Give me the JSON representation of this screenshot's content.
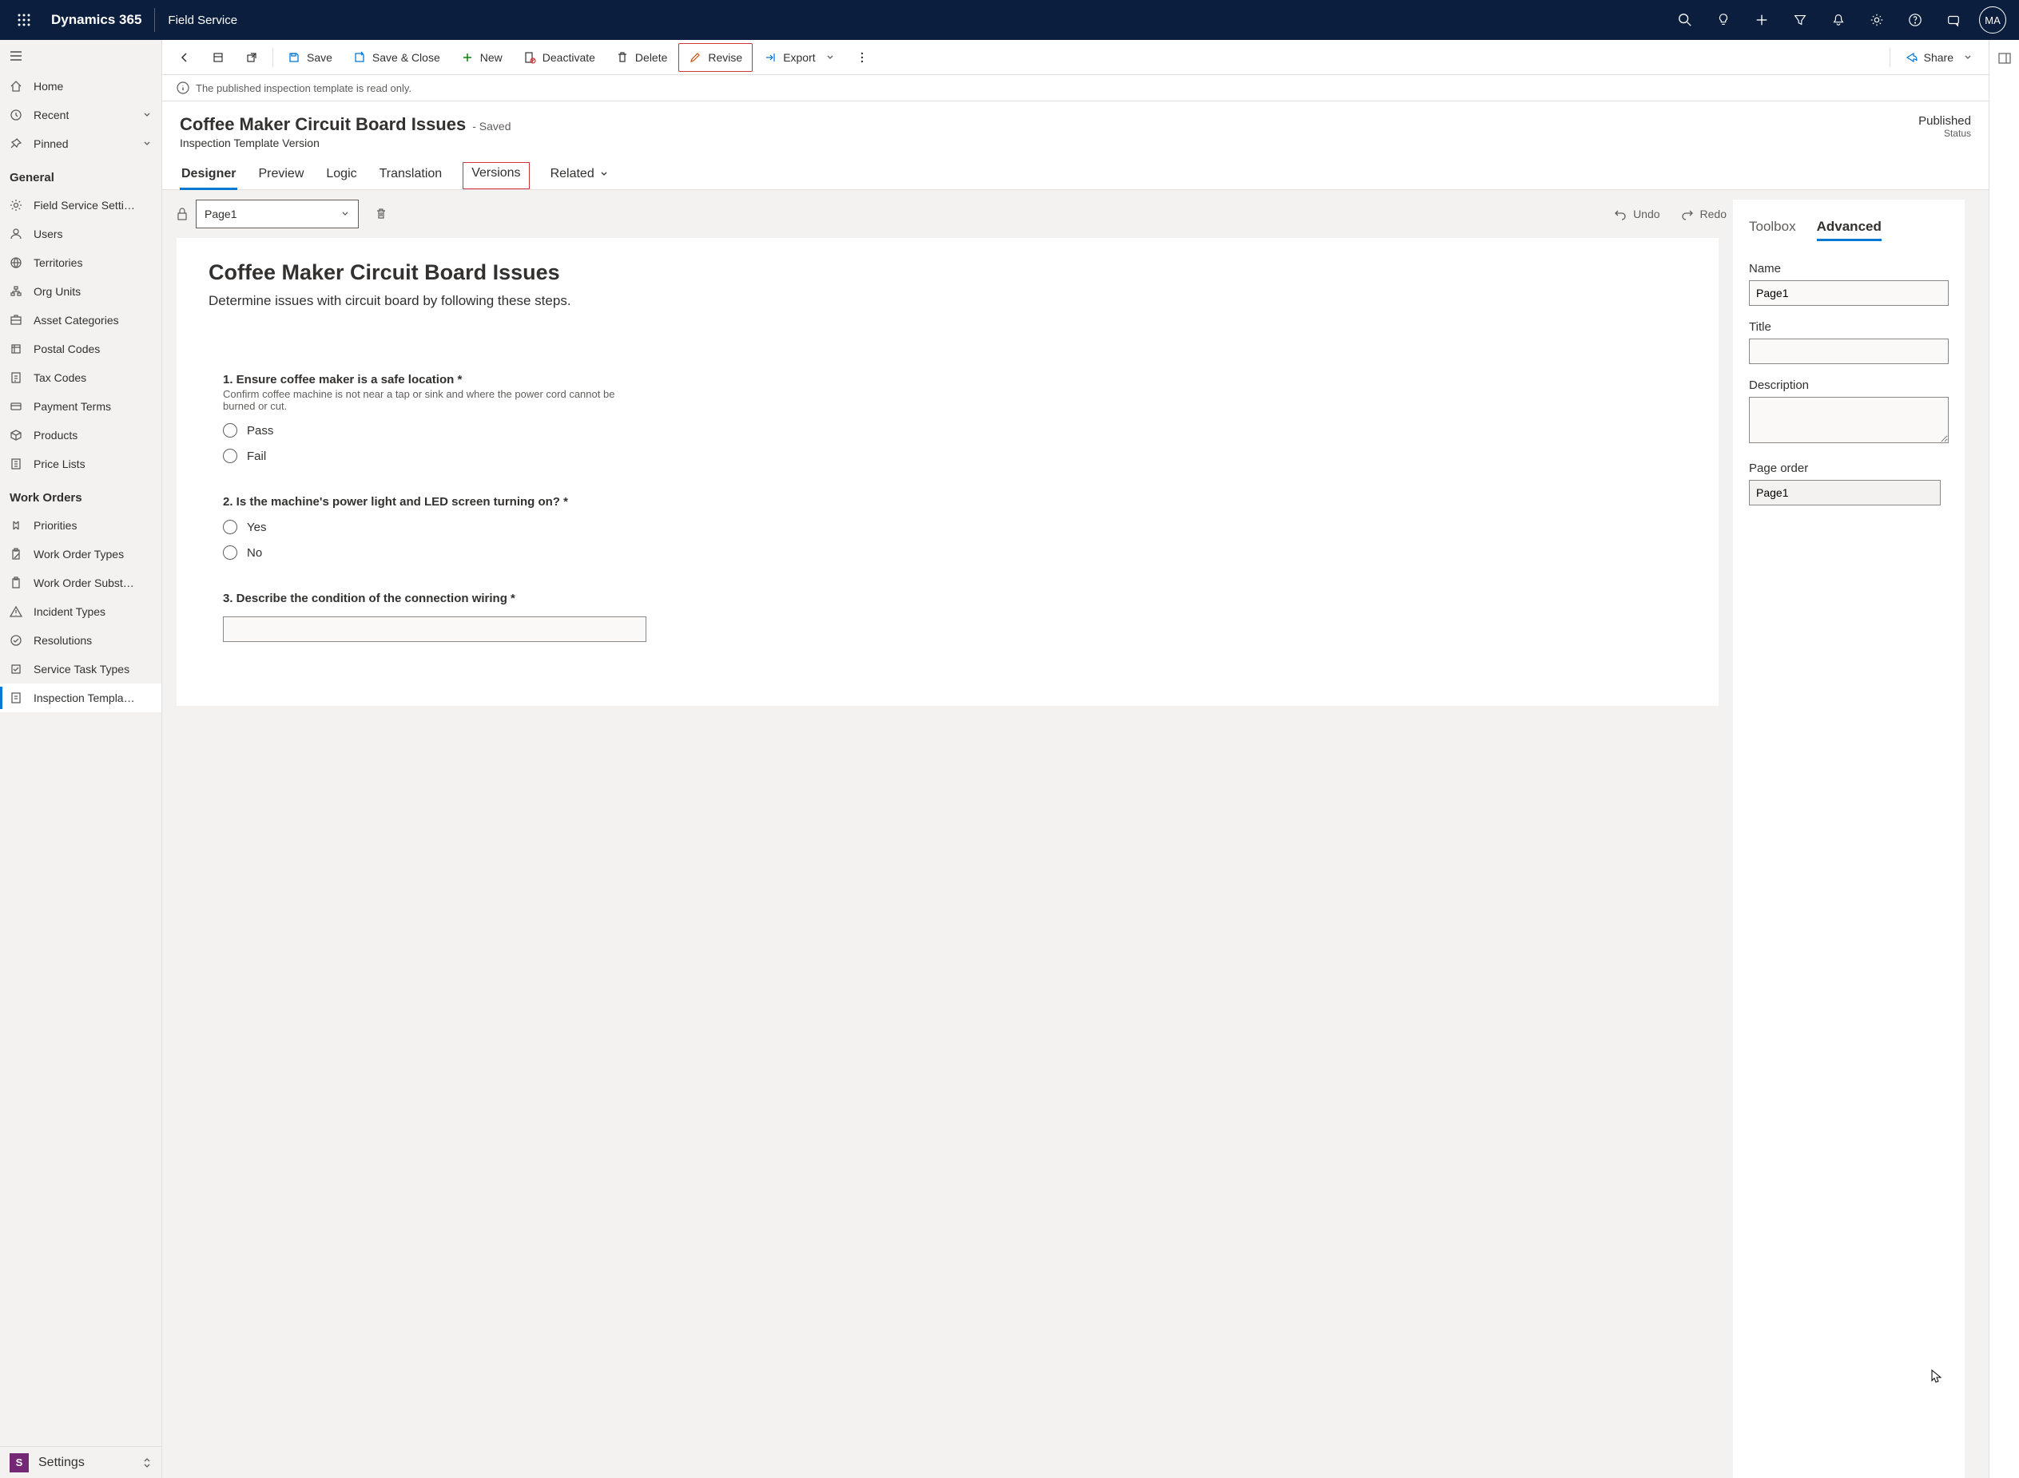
{
  "topnav": {
    "brand": "Dynamics 365",
    "app": "Field Service",
    "avatar_initials": "MA"
  },
  "leftnav": {
    "home": "Home",
    "recent": "Recent",
    "pinned": "Pinned",
    "section_general": "General",
    "general_items": [
      "Field Service Setti…",
      "Users",
      "Territories",
      "Org Units",
      "Asset Categories",
      "Postal Codes",
      "Tax Codes",
      "Payment Terms",
      "Products",
      "Price Lists"
    ],
    "section_work_orders": "Work Orders",
    "wo_items": [
      "Priorities",
      "Work Order Types",
      "Work Order Subst…",
      "Incident Types",
      "Resolutions",
      "Service Task Types",
      "Inspection Templa…"
    ],
    "settings": {
      "badge": "S",
      "label": "Settings"
    }
  },
  "commandbar": {
    "save": "Save",
    "save_close": "Save & Close",
    "new": "New",
    "deactivate": "Deactivate",
    "delete": "Delete",
    "revise": "Revise",
    "export": "Export",
    "share": "Share"
  },
  "banner": {
    "text": "The published inspection template is read only."
  },
  "record": {
    "title": "Coffee Maker Circuit Board Issues",
    "saved_suffix": "- Saved",
    "subtitle": "Inspection Template Version",
    "status_value": "Published",
    "status_label": "Status"
  },
  "tabs": {
    "designer": "Designer",
    "preview": "Preview",
    "logic": "Logic",
    "translation": "Translation",
    "versions": "Versions",
    "related": "Related"
  },
  "designer": {
    "page_selector": "Page1",
    "undo": "Undo",
    "redo": "Redo",
    "canvas_title": "Coffee Maker Circuit Board Issues",
    "canvas_desc": "Determine issues with circuit board by following these steps.",
    "questions": [
      {
        "label": "1. Ensure coffee maker is a safe location",
        "required": true,
        "help": "Confirm coffee machine is not near a tap or sink and where the power cord cannot be burned or cut.",
        "options": [
          "Pass",
          "Fail"
        ]
      },
      {
        "label": "2. Is the machine's power light and LED screen turning on?",
        "required": true,
        "options": [
          "Yes",
          "No"
        ]
      },
      {
        "label": "3. Describe the condition of the connection wiring",
        "required": true,
        "input": true
      }
    ]
  },
  "rightpanel": {
    "tab_toolbox": "Toolbox",
    "tab_advanced": "Advanced",
    "name_label": "Name",
    "name_value": "Page1",
    "title_label": "Title",
    "title_value": "",
    "desc_label": "Description",
    "desc_value": "",
    "order_label": "Page order",
    "order_value": "Page1"
  }
}
